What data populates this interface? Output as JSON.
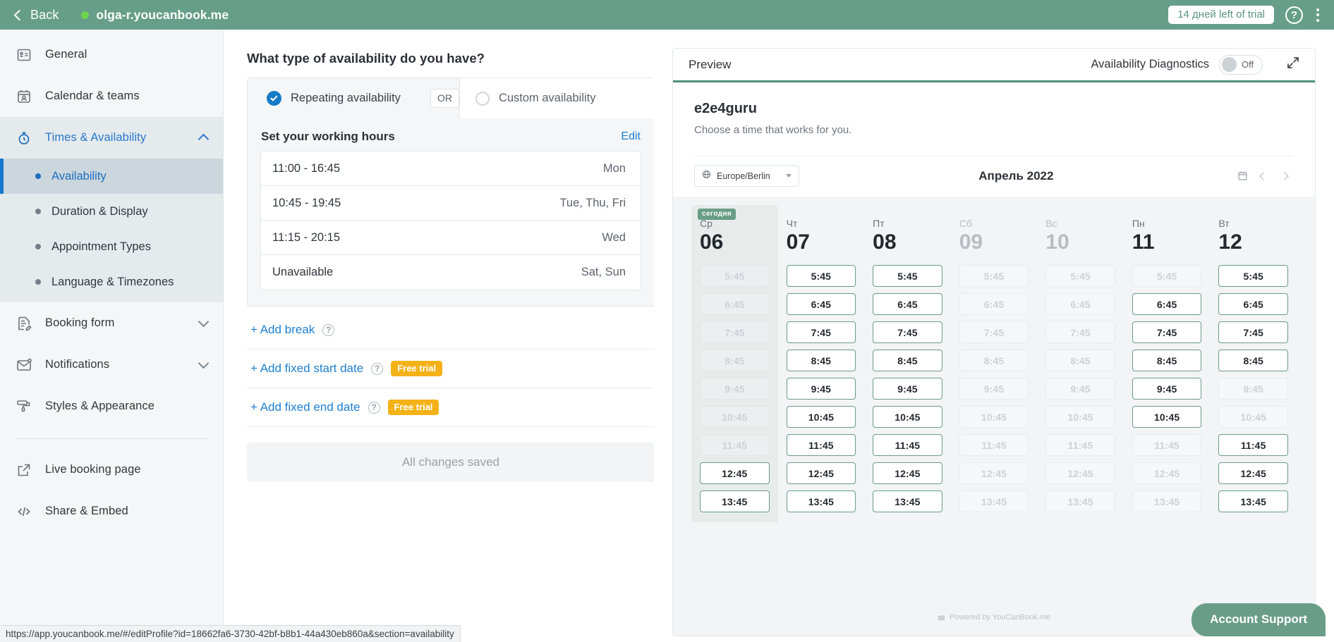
{
  "topbar": {
    "back_label": "Back",
    "site_name": "olga-r.youcanbook.me",
    "trial_label": "14 дней left of trial",
    "help_label": "?",
    "dot_color": "#6fd44a",
    "bg_color": "#669e89"
  },
  "sidebar": {
    "items": [
      {
        "label": "General",
        "icon": "contact-card-icon"
      },
      {
        "label": "Calendar & teams",
        "icon": "calendar-person-icon"
      },
      {
        "label": "Times & Availability",
        "icon": "stopwatch-icon",
        "expanded": true
      },
      {
        "label": "Booking form",
        "icon": "form-edit-icon",
        "expanded": false
      },
      {
        "label": "Notifications",
        "icon": "envelope-icon",
        "expanded": false
      },
      {
        "label": "Styles & Appearance",
        "icon": "paint-roller-icon"
      }
    ],
    "sub_items": [
      {
        "label": "Availability",
        "active": true
      },
      {
        "label": "Duration & Display",
        "active": false
      },
      {
        "label": "Appointment Types",
        "active": false
      },
      {
        "label": "Language & Timezones",
        "active": false
      }
    ],
    "footer_items": [
      {
        "label": "Live booking page",
        "icon": "external-link-icon"
      },
      {
        "label": "Share & Embed",
        "icon": "code-icon"
      }
    ]
  },
  "main": {
    "question_title": "What type of availability do you have?",
    "tabs": [
      {
        "label": "Repeating availability",
        "selected": true
      },
      {
        "label": "Custom availability",
        "selected": false
      }
    ],
    "or_chip": "OR",
    "working_hours_title": "Set your working hours",
    "edit_link": "Edit",
    "hours_rows": [
      {
        "time": "11:00 - 16:45",
        "days": "Mon"
      },
      {
        "time": "10:45 - 19:45",
        "days": "Tue, Thu, Fri"
      },
      {
        "time": "11:15 - 20:15",
        "days": "Wed"
      },
      {
        "time": "Unavailable",
        "days": "Sat, Sun"
      }
    ],
    "actions": [
      {
        "label": "+ Add break",
        "help": "?",
        "badge": null
      },
      {
        "label": "+ Add fixed start date",
        "help": "?",
        "badge": "Free trial"
      },
      {
        "label": "+ Add fixed end date",
        "help": "?",
        "badge": "Free trial"
      }
    ],
    "save_status": "All changes saved"
  },
  "preview": {
    "title": "Preview",
    "diagnostics_label": "Availability Diagnostics",
    "toggle_state": "Off",
    "expand_icon": "expand-icon",
    "booking": {
      "brand": "e2e4guru",
      "subtitle": "Choose a time that works for you.",
      "timezone": "Europe/Berlin",
      "timezone_icon": "globe-icon",
      "month": "Апрель 2022",
      "calendar_icon": "calendar-icon",
      "prev_icon": "chevron-left-icon",
      "next_icon": "chevron-right-icon",
      "today_badge": "сегодня",
      "times": [
        "5:45",
        "6:45",
        "7:45",
        "8:45",
        "9:45",
        "10:45",
        "11:45",
        "12:45",
        "13:45"
      ],
      "days": [
        {
          "dow": "Ср",
          "num": "06",
          "today": true,
          "off": false,
          "slots": [
            false,
            false,
            false,
            false,
            false,
            false,
            false,
            true,
            true
          ]
        },
        {
          "dow": "Чт",
          "num": "07",
          "today": false,
          "off": false,
          "slots": [
            true,
            true,
            true,
            true,
            true,
            true,
            true,
            true,
            true
          ]
        },
        {
          "dow": "Пт",
          "num": "08",
          "today": false,
          "off": false,
          "slots": [
            true,
            true,
            true,
            true,
            true,
            true,
            true,
            true,
            true
          ]
        },
        {
          "dow": "Сб",
          "num": "09",
          "today": false,
          "off": true,
          "slots": [
            false,
            false,
            false,
            false,
            false,
            false,
            false,
            false,
            false
          ]
        },
        {
          "dow": "Вс",
          "num": "10",
          "today": false,
          "off": true,
          "slots": [
            false,
            false,
            false,
            false,
            false,
            false,
            false,
            false,
            false
          ]
        },
        {
          "dow": "Пн",
          "num": "11",
          "today": false,
          "off": false,
          "slots": [
            false,
            true,
            true,
            true,
            true,
            true,
            false,
            false,
            false
          ]
        },
        {
          "dow": "Вт",
          "num": "12",
          "today": false,
          "off": false,
          "slots": [
            true,
            true,
            true,
            true,
            false,
            false,
            true,
            true,
            true
          ]
        }
      ]
    }
  },
  "account_support": {
    "label": "Account Support"
  },
  "statusbar": {
    "url": "https://app.youcanbook.me/#/editProfile?id=18662fa6-3730-42bf-b8b1-44a430eb860a&section=availability"
  }
}
